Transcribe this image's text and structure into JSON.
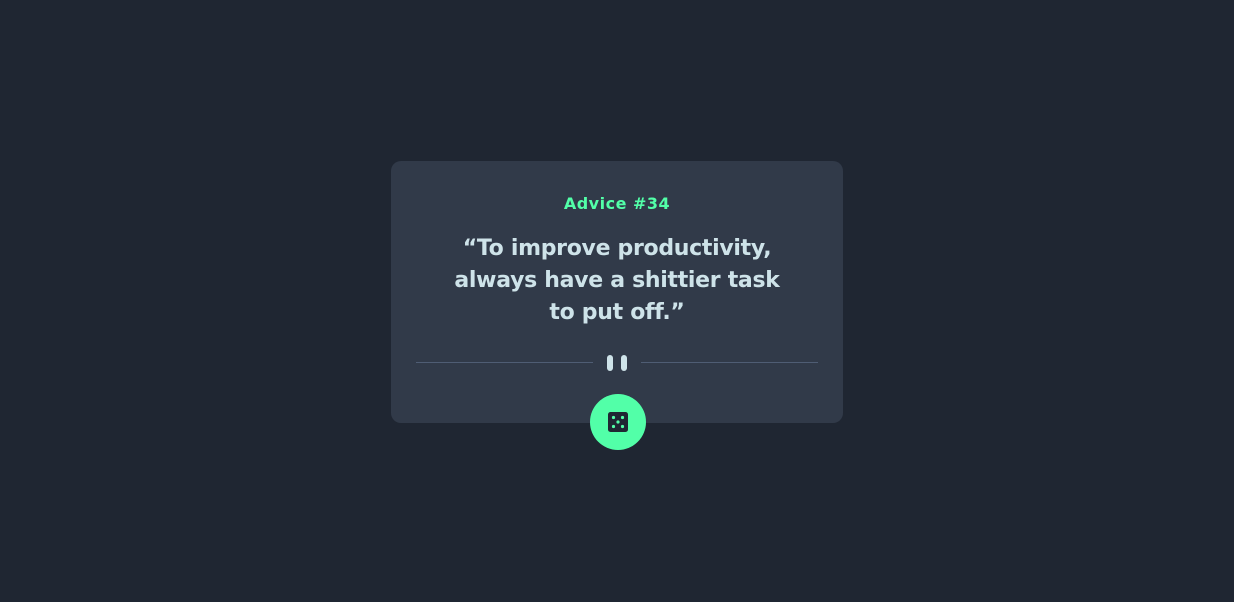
{
  "advice": {
    "id_label": "Advice #34",
    "quote": "“To improve productivity, always have a shittier task to put off.”"
  },
  "divider": {
    "icon": "pause-icon"
  },
  "dice_button": {
    "icon": "dice-icon"
  },
  "colors": {
    "background": "#1f2632",
    "card": "#313a49",
    "accent": "#52ffa8",
    "quote_text": "#cee3e9",
    "divider": "#4f5d74"
  }
}
